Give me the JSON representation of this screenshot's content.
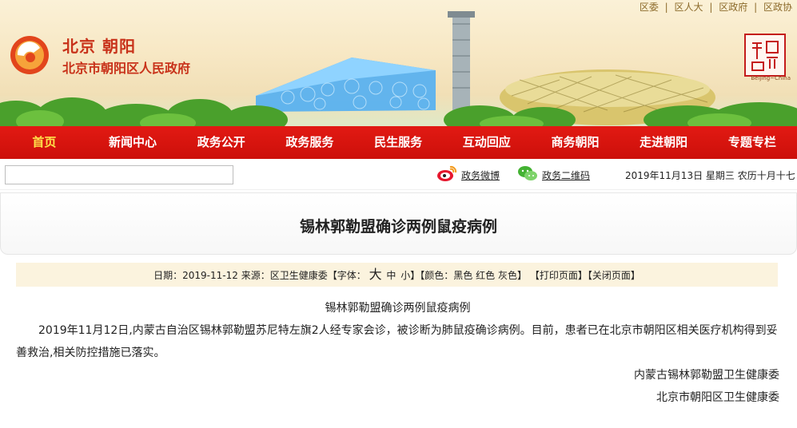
{
  "top_links": [
    "区委",
    "区人大",
    "区政府",
    "区政协"
  ],
  "brand": {
    "short_name": "北京 朝阳",
    "full_name": "北京市朝阳区人民政府",
    "seal_caption": "Beijing~China"
  },
  "nav": {
    "items": [
      {
        "label": "首页",
        "active": true
      },
      {
        "label": "新闻中心",
        "active": false
      },
      {
        "label": "政务公开",
        "active": false
      },
      {
        "label": "政务服务",
        "active": false
      },
      {
        "label": "民生服务",
        "active": false
      },
      {
        "label": "互动回应",
        "active": false
      },
      {
        "label": "商务朝阳",
        "active": false
      },
      {
        "label": "走进朝阳",
        "active": false
      },
      {
        "label": "专题专栏",
        "active": false
      }
    ]
  },
  "subbar": {
    "search_value": "",
    "weibo_label": "政务微博",
    "wechat_label": "政务二维码",
    "date_text": "2019年11月13日 星期三 农历十月十七"
  },
  "article": {
    "title": "锡林郭勒盟确诊两例鼠疫病例",
    "meta": {
      "date_label": "日期：",
      "date": "2019-11-12",
      "source_label": "来源：",
      "source": "区卫生健康委",
      "font_label": "【字体：",
      "font_large": "大",
      "font_medium": "中",
      "font_small": "小",
      "color_label": "】【颜色：",
      "color_black": "黑色",
      "color_red": "红色",
      "color_gray": "灰色",
      "close_bracket": "】",
      "print": "【打印页面】",
      "close": "【关闭页面】"
    },
    "subtitle": "锡林郭勒盟确诊两例鼠疫病例",
    "paragraph": "2019年11月12日,内蒙古自治区锡林郭勒盟苏尼特左旗2人经专家会诊，被诊断为肺鼠疫确诊病例。目前，患者已在北京市朝阳区相关医疗机构得到妥善救治,相关防控措施已落实。",
    "signatures": [
      "内蒙古锡林郭勒盟卫生健康委",
      "北京市朝阳区卫生健康委"
    ]
  },
  "colors": {
    "nav_red": "#d8140e",
    "nav_active_text": "#ffe14a",
    "brand_red": "#c8321a",
    "meta_bg": "#fbf3de"
  }
}
